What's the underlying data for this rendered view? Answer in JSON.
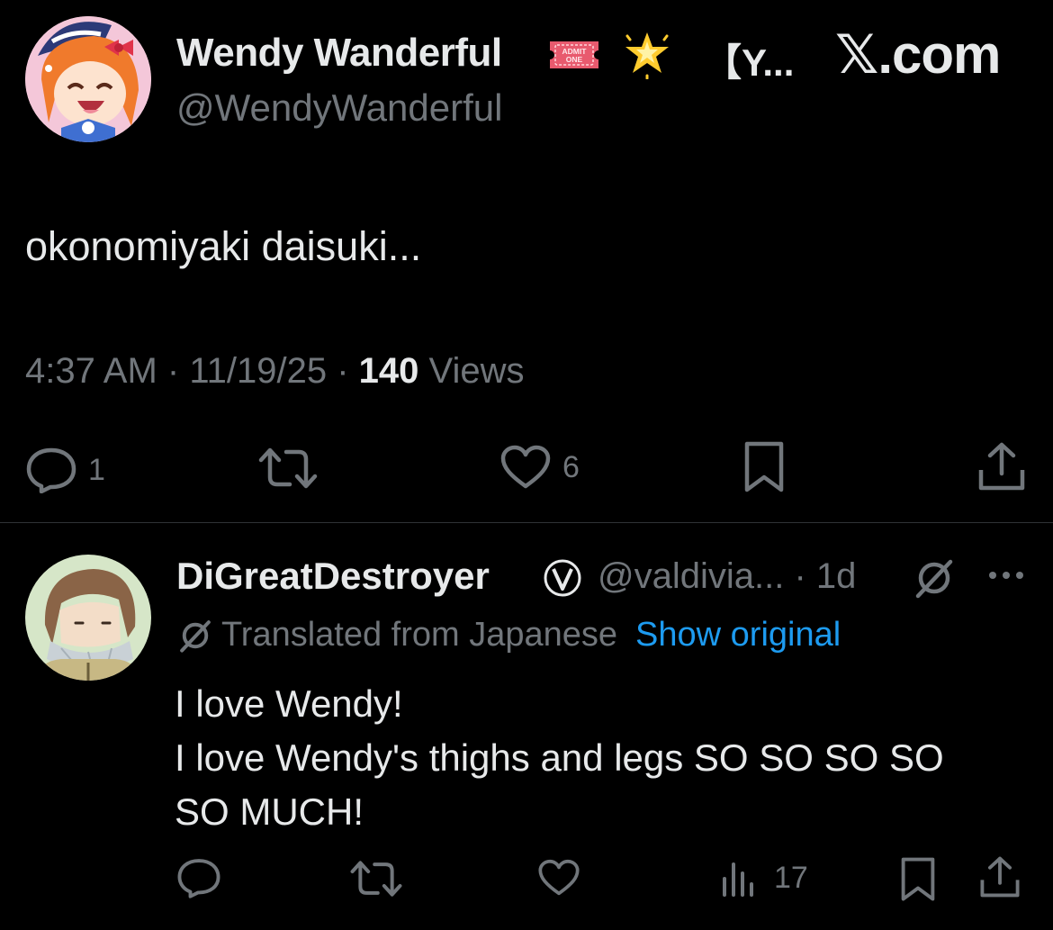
{
  "tweet": {
    "author": {
      "display_name": "Wendy Wanderful",
      "ticket_badge_text": "ADMIT ONE",
      "name_suffix": "【Y...",
      "handle": "@WendyWanderful"
    },
    "site_brand": "𝕏.com",
    "text": "okonomiyaki daisuki...",
    "time": "4:37 AM",
    "date": "11/19/25",
    "views_count": "140",
    "views_label": "Views",
    "separator": "·",
    "actions": {
      "reply_count": "1",
      "like_count": "6"
    }
  },
  "reply": {
    "display_name": "DiGreatDestroyer",
    "verified_glyph": "Ⓥ",
    "handle": "@valdivia...",
    "age": "1d",
    "translation_label": "Translated from Japanese",
    "show_original_label": "Show original",
    "text_lines": [
      "I love Wendy!",
      "I love Wendy's thighs and legs SO SO SO SO",
      "SO MUCH!"
    ],
    "actions": {
      "views_count": "17"
    }
  },
  "colors": {
    "background": "#000000",
    "primary_text": "#e7e9ea",
    "secondary_text": "#71767b",
    "link": "#1d9bf0",
    "divider": "#2f3336"
  },
  "icons": [
    "reply-icon",
    "retweet-icon",
    "like-icon",
    "bookmark-icon",
    "share-icon",
    "views-icon",
    "star-emoji-icon",
    "ticket-emoji-icon",
    "no-symbol-icon",
    "more-icon"
  ]
}
